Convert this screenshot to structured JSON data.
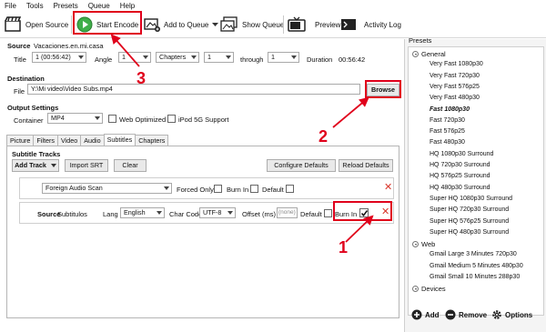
{
  "menu": [
    "File",
    "Tools",
    "Presets",
    "Queue",
    "Help"
  ],
  "toolbar": {
    "open_source": "Open Source",
    "start_encode": "Start Encode",
    "add_to_queue": "Add to Queue",
    "show_queue": "Show Queue",
    "preview": "Preview",
    "activity_log": "Activity Log"
  },
  "source": {
    "label": "Source",
    "name": "Vacaciones.en.mi.casa",
    "title_label": "Title",
    "title_value": "1 (00:56:42)",
    "angle_label": "Angle",
    "angle_value": "1",
    "range_value": "Chapters",
    "from_value": "1",
    "through_label": "through",
    "to_value": "1",
    "duration_label": "Duration",
    "duration_value": "00:56:42"
  },
  "destination": {
    "label": "Destination",
    "file_label": "File",
    "file_value": "Y:\\Mi video\\Video Subs.mp4",
    "browse": "Browse"
  },
  "output": {
    "label": "Output Settings",
    "container_label": "Container",
    "container_value": "MP4",
    "web_optimized": "Web Optimized",
    "ipod": "iPod 5G Support"
  },
  "tabs": [
    "Picture",
    "Filters",
    "Video",
    "Audio",
    "Subtitles",
    "Chapters"
  ],
  "subtitles": {
    "section_label": "Subtitle Tracks",
    "add_track": "Add Track",
    "import_srt": "Import SRT",
    "clear": "Clear",
    "configure_defaults": "Configure Defaults",
    "reload_defaults": "Reload Defaults",
    "row1": {
      "track": "Foreign Audio Scan",
      "forced_only": "Forced Only",
      "burn_in": "Burn In",
      "default": "Default"
    },
    "row2": {
      "source_label": "Source",
      "source_value": "Subtitulos",
      "lang_label": "Lang",
      "lang_value": "English",
      "charcode_label": "Char Code",
      "charcode_value": "UTF-8",
      "offset_label": "Offset (ms)",
      "offset_value": "(none)",
      "default": "Default",
      "burn_in": "Burn In"
    }
  },
  "presets": {
    "title": "Presets",
    "groups": [
      {
        "name": "General",
        "items": [
          "Very Fast 1080p30",
          "Very Fast 720p30",
          "Very Fast 576p25",
          "Very Fast 480p30",
          "Fast 1080p30",
          "Fast 720p30",
          "Fast 576p25",
          "Fast 480p30",
          "HQ 1080p30 Surround",
          "HQ 720p30 Surround",
          "HQ 576p25 Surround",
          "HQ 480p30 Surround",
          "Super HQ 1080p30 Surround",
          "Super HQ 720p30 Surround",
          "Super HQ 576p25 Surround",
          "Super HQ 480p30 Surround"
        ]
      },
      {
        "name": "Web",
        "items": [
          "Gmail Large 3 Minutes 720p30",
          "Gmail Medium 5 Minutes 480p30",
          "Gmail Small 10 Minutes 288p30"
        ]
      },
      {
        "name": "Devices",
        "items": []
      }
    ],
    "selected": "Fast 1080p30",
    "add": "Add",
    "remove": "Remove",
    "options": "Options"
  },
  "annotations": {
    "n1": "1",
    "n2": "2",
    "n3": "3"
  },
  "colors": {
    "annotation_red": "#e0001b",
    "play_green": "#3fae49"
  }
}
